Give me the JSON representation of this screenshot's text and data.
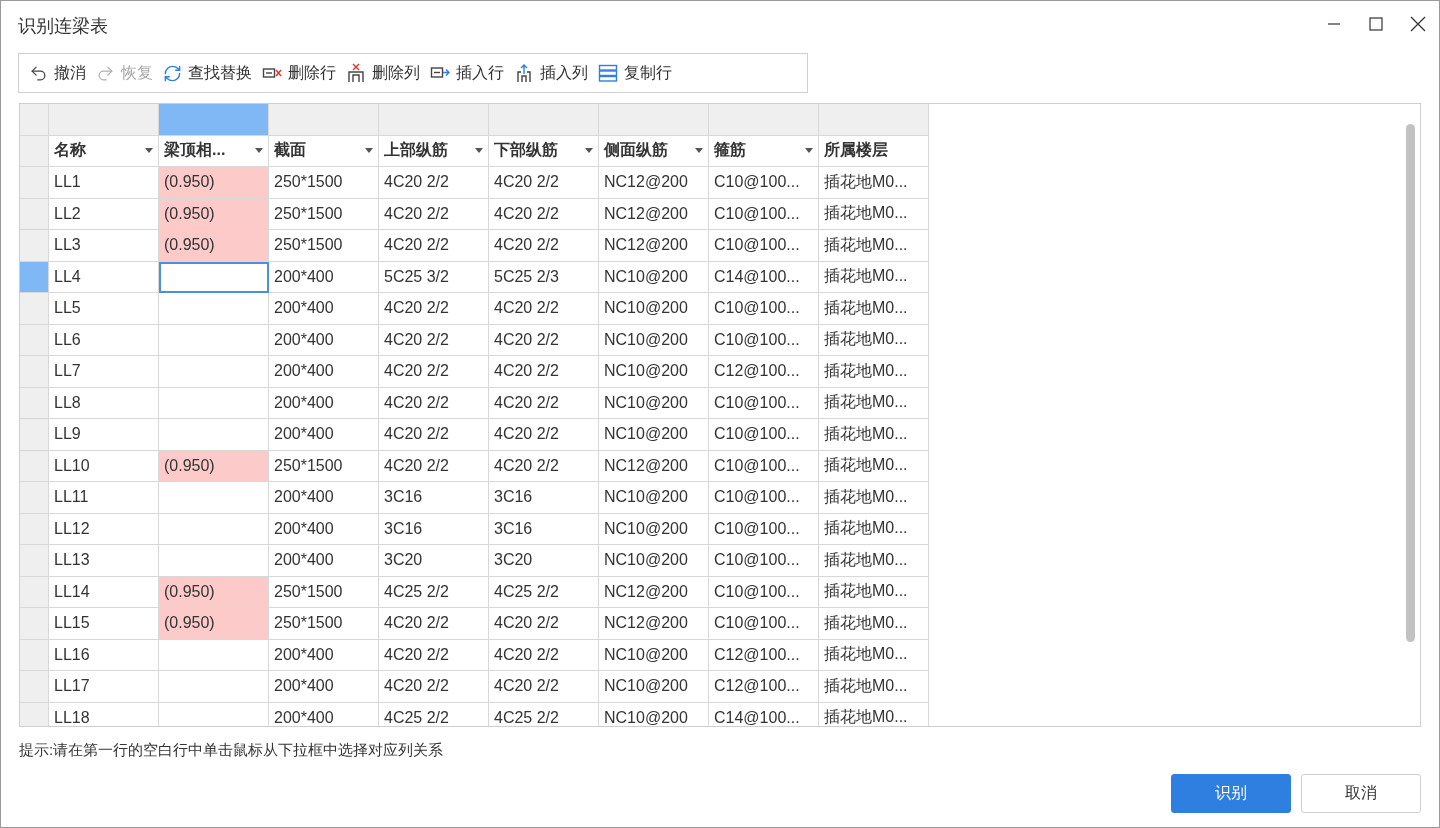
{
  "window": {
    "title": "识别连梁表"
  },
  "toolbar": [
    {
      "kind": "undo",
      "label": "撤消",
      "disabled": false
    },
    {
      "kind": "redo",
      "label": "恢复",
      "disabled": true
    },
    {
      "kind": "find",
      "label": "查找替换",
      "disabled": false
    },
    {
      "kind": "delrow",
      "label": "删除行",
      "disabled": false
    },
    {
      "kind": "delcol",
      "label": "删除列",
      "disabled": false
    },
    {
      "kind": "insrow",
      "label": "插入行",
      "disabled": false
    },
    {
      "kind": "inscol",
      "label": "插入列",
      "disabled": false
    },
    {
      "kind": "copyrow",
      "label": "复制行",
      "disabled": false
    }
  ],
  "table": {
    "columns": [
      {
        "label": "名称",
        "selected": false,
        "dropdown": true
      },
      {
        "label": "梁顶相...",
        "selected": true,
        "dropdown": true
      },
      {
        "label": "截面",
        "selected": false,
        "dropdown": true
      },
      {
        "label": "上部纵筋",
        "selected": false,
        "dropdown": true
      },
      {
        "label": "下部纵筋",
        "selected": false,
        "dropdown": true
      },
      {
        "label": "侧面纵筋",
        "selected": false,
        "dropdown": true
      },
      {
        "label": "箍筋",
        "selected": false,
        "dropdown": true
      },
      {
        "label": "所属楼层",
        "selected": false,
        "dropdown": false
      }
    ],
    "rows": [
      {
        "selected": false,
        "flagged": true,
        "cells": [
          "LL1",
          "(0.950)",
          "250*1500",
          "4C20 2/2",
          "4C20 2/2",
          "NC12@200",
          "C10@100...",
          "插花地M0..."
        ]
      },
      {
        "selected": false,
        "flagged": true,
        "cells": [
          "LL2",
          "(0.950)",
          "250*1500",
          "4C20 2/2",
          "4C20 2/2",
          "NC12@200",
          "C10@100...",
          "插花地M0..."
        ]
      },
      {
        "selected": false,
        "flagged": true,
        "cells": [
          "LL3",
          "(0.950)",
          "250*1500",
          "4C20 2/2",
          "4C20 2/2",
          "NC12@200",
          "C10@100...",
          "插花地M0..."
        ]
      },
      {
        "selected": true,
        "flagged": false,
        "cells": [
          "LL4",
          null,
          "200*400",
          "5C25 3/2",
          "5C25 2/3",
          "NC10@200",
          "C14@100...",
          "插花地M0..."
        ]
      },
      {
        "selected": false,
        "flagged": false,
        "cells": [
          "LL5",
          null,
          "200*400",
          "4C20 2/2",
          "4C20 2/2",
          "NC10@200",
          "C10@100...",
          "插花地M0..."
        ]
      },
      {
        "selected": false,
        "flagged": false,
        "cells": [
          "LL6",
          null,
          "200*400",
          "4C20 2/2",
          "4C20 2/2",
          "NC10@200",
          "C10@100...",
          "插花地M0..."
        ]
      },
      {
        "selected": false,
        "flagged": false,
        "cells": [
          "LL7",
          null,
          "200*400",
          "4C20 2/2",
          "4C20 2/2",
          "NC10@200",
          "C12@100...",
          "插花地M0..."
        ]
      },
      {
        "selected": false,
        "flagged": false,
        "cells": [
          "LL8",
          null,
          "200*400",
          "4C20 2/2",
          "4C20 2/2",
          "NC10@200",
          "C10@100...",
          "插花地M0..."
        ]
      },
      {
        "selected": false,
        "flagged": false,
        "cells": [
          "LL9",
          null,
          "200*400",
          "4C20 2/2",
          "4C20 2/2",
          "NC10@200",
          "C10@100...",
          "插花地M0..."
        ]
      },
      {
        "selected": false,
        "flagged": true,
        "cells": [
          "LL10",
          "(0.950)",
          "250*1500",
          "4C20 2/2",
          "4C20 2/2",
          "NC12@200",
          "C10@100...",
          "插花地M0..."
        ]
      },
      {
        "selected": false,
        "flagged": false,
        "cells": [
          "LL11",
          null,
          "200*400",
          "3C16",
          "3C16",
          "NC10@200",
          "C10@100...",
          "插花地M0..."
        ]
      },
      {
        "selected": false,
        "flagged": false,
        "cells": [
          "LL12",
          null,
          "200*400",
          "3C16",
          "3C16",
          "NC10@200",
          "C10@100...",
          "插花地M0..."
        ]
      },
      {
        "selected": false,
        "flagged": false,
        "cells": [
          "LL13",
          null,
          "200*400",
          "3C20",
          "3C20",
          "NC10@200",
          "C10@100...",
          "插花地M0..."
        ]
      },
      {
        "selected": false,
        "flagged": true,
        "cells": [
          "LL14",
          "(0.950)",
          "250*1500",
          "4C25 2/2",
          "4C25 2/2",
          "NC12@200",
          "C10@100...",
          "插花地M0..."
        ]
      },
      {
        "selected": false,
        "flagged": true,
        "cells": [
          "LL15",
          "(0.950)",
          "250*1500",
          "4C20 2/2",
          "4C20 2/2",
          "NC12@200",
          "C10@100...",
          "插花地M0..."
        ]
      },
      {
        "selected": false,
        "flagged": false,
        "cells": [
          "LL16",
          null,
          "200*400",
          "4C20 2/2",
          "4C20 2/2",
          "NC10@200",
          "C12@100...",
          "插花地M0..."
        ]
      },
      {
        "selected": false,
        "flagged": false,
        "cells": [
          "LL17",
          null,
          "200*400",
          "4C20 2/2",
          "4C20 2/2",
          "NC10@200",
          "C12@100...",
          "插花地M0..."
        ]
      },
      {
        "selected": false,
        "flagged": false,
        "cells": [
          "LL18",
          null,
          "200*400",
          "4C25 2/2",
          "4C25 2/2",
          "NC10@200",
          "C14@100...",
          "插花地M0..."
        ]
      }
    ]
  },
  "hint": "提示:请在第一行的空白行中单击鼠标从下拉框中选择对应列关系",
  "buttons": [
    {
      "label": "识别",
      "primary": true
    },
    {
      "label": "取消",
      "primary": false
    }
  ]
}
